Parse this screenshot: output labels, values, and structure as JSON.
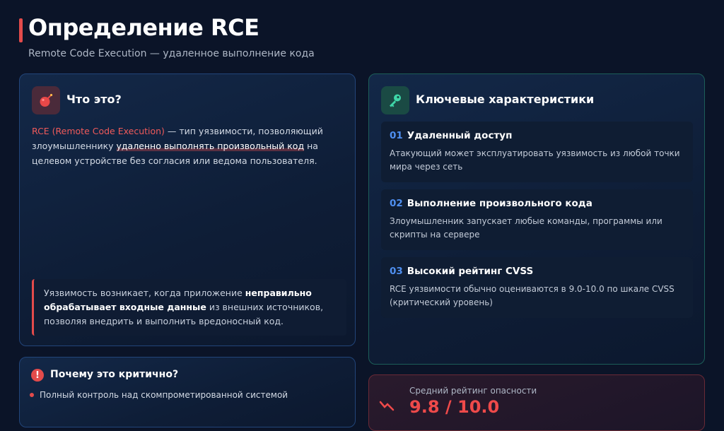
{
  "header": {
    "title": "Определение RCE",
    "subtitle": "Remote Code Execution — удаленное выполнение кода"
  },
  "what": {
    "icon": "bomb-icon",
    "heading": "Что это?",
    "def_term": "RCE (Remote Code Execution)",
    "def_part1": " — тип уязвимости, позволяющий злоумышленнику ",
    "def_highlight": "удаленно выполнять произвольный код",
    "def_part2": " на целевом устройстве без согласия или ведома пользователя.",
    "note_part1": "Уязвимость возникает, когда приложение ",
    "note_bold": "неправильно обрабатывает входные данные",
    "note_part2": " из внешних источников, позволяя внедрить и выполнить вредоносный код."
  },
  "keys": {
    "icon": "key-icon",
    "heading": "Ключевые характеристики",
    "items": [
      {
        "num": "01",
        "title": "Удаленный доступ",
        "desc": "Атакующий может эксплуатировать уязвимость из любой точки мира через сеть"
      },
      {
        "num": "02",
        "title": "Выполнение произвольного кода",
        "desc": "Злоумышленник запускает любые команды, программы или скрипты на сервере"
      },
      {
        "num": "03",
        "title": "Высокий рейтинг CVSS",
        "desc": "RCE уязвимости обычно оцениваются в 9.0-10.0 по шкале CVSS (критический уровень)"
      }
    ]
  },
  "why": {
    "icon": "alert-icon",
    "icon_glyph": "!",
    "heading": "Почему это критично?",
    "items": [
      "Полный контроль над скомпрометированной системой"
    ]
  },
  "cvss": {
    "icon": "trend-icon",
    "label": "Средний рейтинг опасности",
    "value": "9.8 / 10.0"
  },
  "colors": {
    "accent_red": "#e34b4b",
    "accent_blue": "#4f8ff0",
    "accent_teal": "#2ec4a0"
  }
}
